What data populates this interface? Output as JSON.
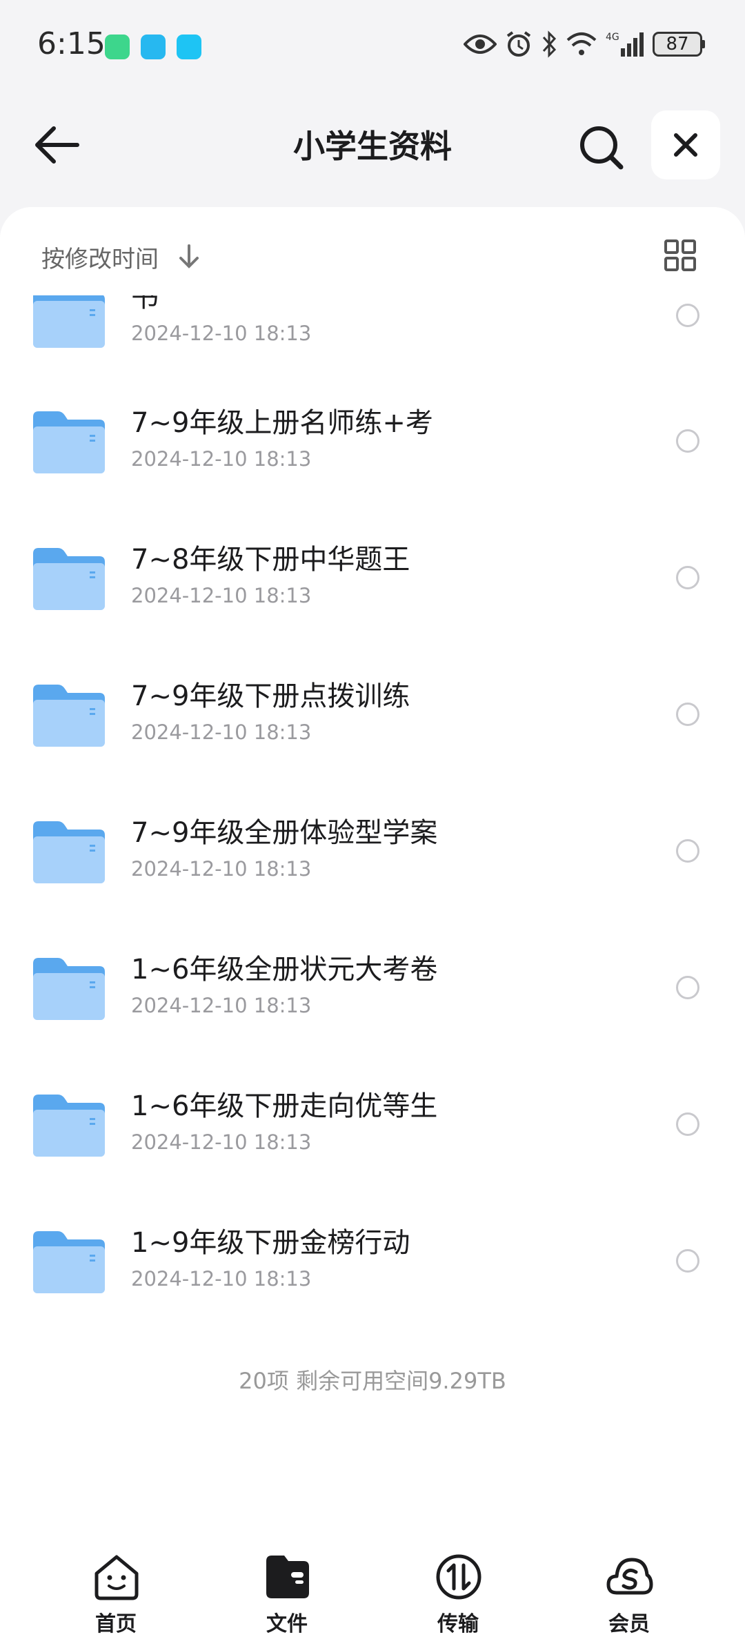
{
  "status": {
    "time": "6:15",
    "battery": "87",
    "network": "4G"
  },
  "header": {
    "title": "小学生资料"
  },
  "sort": {
    "label": "按修改时间"
  },
  "files": [
    {
      "name": "书",
      "date": "2024-12-10 18:13"
    },
    {
      "name": "7~9年级上册名师练+考",
      "date": "2024-12-10 18:13"
    },
    {
      "name": "7~8年级下册中华题王",
      "date": "2024-12-10 18:13"
    },
    {
      "name": "7~9年级下册点拨训练",
      "date": "2024-12-10 18:13"
    },
    {
      "name": "7~9年级全册体验型学案",
      "date": "2024-12-10 18:13"
    },
    {
      "name": "1~6年级全册状元大考卷",
      "date": "2024-12-10 18:13"
    },
    {
      "name": "1~6年级下册走向优等生",
      "date": "2024-12-10 18:13"
    },
    {
      "name": "1~9年级下册金榜行动",
      "date": "2024-12-10 18:13"
    }
  ],
  "summary": "20项 剩余可用空间9.29TB",
  "nav": [
    {
      "label": "首页",
      "icon": "smile-face-icon"
    },
    {
      "label": "文件",
      "icon": "folder-wallet-icon"
    },
    {
      "label": "传输",
      "icon": "transfer-arrows-icon"
    },
    {
      "label": "会员",
      "icon": "cloud-s-icon"
    }
  ],
  "colors": {
    "folder": "#5aa8ee",
    "folder_light": "#a7d1fa",
    "card": "#ffffff",
    "background": "#f4f4f6"
  }
}
